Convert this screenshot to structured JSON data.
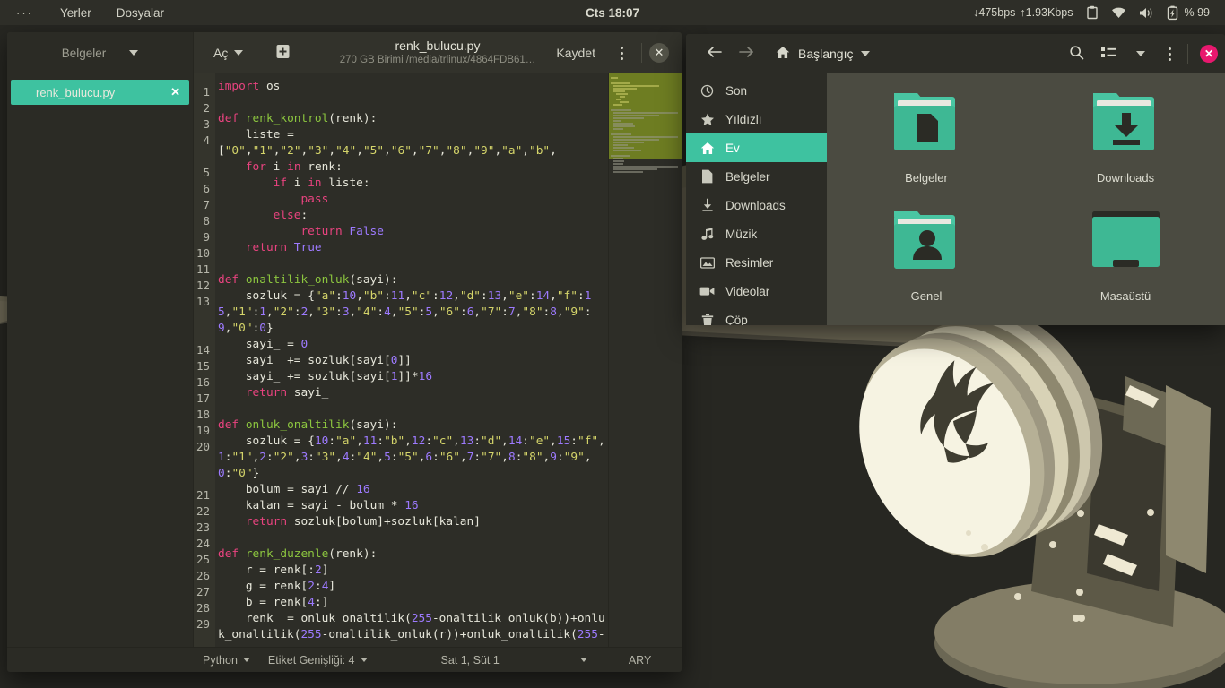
{
  "topbar": {
    "menu_dots": "···",
    "places_label": "Yerler",
    "files_label": "Dosyalar",
    "clock": "Cts 18:07",
    "network_down": "↓475bps",
    "network_up": "↑1.93Kbps",
    "battery_percent": "% 99",
    "icons": [
      "clipboard-icon",
      "wifi-icon",
      "volume-icon",
      "battery-charging-icon"
    ]
  },
  "editor": {
    "sidebar_header": "Belgeler",
    "open_label": "Aç",
    "save_label": "Kaydet",
    "title": "renk_bulucu.py",
    "subtitle": "270 GB Birimi /media/trlinux/4864FDB61…",
    "tab_label": "renk_bulucu.py",
    "tab_close": "✕",
    "window_close": "✕",
    "status": {
      "language": "Python",
      "tab_width": "Etiket Genişliği: 4",
      "cursor": "Sat 1, Süt 1",
      "mode": "ARY"
    },
    "line_numbers": [
      "1",
      "2",
      "3",
      "4",
      "5",
      "6",
      "7",
      "8",
      "9",
      "10",
      "11",
      "12",
      "13",
      "14",
      "15",
      "16",
      "17",
      "18",
      "19",
      "20",
      "21",
      "22",
      "23",
      "24",
      "25",
      "26",
      "27",
      "28",
      "29"
    ],
    "code_lines": [
      {
        "n": 1,
        "text": "import os"
      },
      {
        "n": 2,
        "text": ""
      },
      {
        "n": 3,
        "text": "def renk_kontrol(renk):"
      },
      {
        "n": 4,
        "text": "    liste = [\"0\",\"1\",\"2\",\"3\",\"4\",\"5\",\"6\",\"7\",\"8\",\"9\",\"a\",\"b\","
      },
      {
        "n": 5,
        "text": "    for i in renk:"
      },
      {
        "n": 6,
        "text": "        if i in liste:"
      },
      {
        "n": 7,
        "text": "            pass"
      },
      {
        "n": 8,
        "text": "        else:"
      },
      {
        "n": 9,
        "text": "            return False"
      },
      {
        "n": 10,
        "text": "    return True"
      },
      {
        "n": 11,
        "text": ""
      },
      {
        "n": 12,
        "text": "def onaltilik_onluk(sayi):"
      },
      {
        "n": 13,
        "text": "    sozluk = {\"a\":10,\"b\":11,\"c\":12,\"d\":13,\"e\":14,\"f\":15,\"1\":1,\"2\":2,\"3\":3,\"4\":4,\"5\":5,\"6\":6,\"7\":7,\"8\":8,\"9\":9,\"0\":0}"
      },
      {
        "n": 14,
        "text": "    sayi_ = 0"
      },
      {
        "n": 15,
        "text": "    sayi_ += sozluk[sayi[0]]"
      },
      {
        "n": 16,
        "text": "    sayi_ += sozluk[sayi[1]]*16"
      },
      {
        "n": 17,
        "text": "    return sayi_"
      },
      {
        "n": 18,
        "text": ""
      },
      {
        "n": 19,
        "text": "def onluk_onaltilik(sayi):"
      },
      {
        "n": 20,
        "text": "    sozluk = {10:\"a\",11:\"b\",12:\"c\",13:\"d\",14:\"e\",15:\"f\",1:\"1\",2:\"2\",3:\"3\",4:\"4\",5:\"5\",6:\"6\",7:\"7\",8:\"8\",9:\"9\",0:\"0\"}"
      },
      {
        "n": 21,
        "text": "    bolum = sayi // 16"
      },
      {
        "n": 22,
        "text": "    kalan = sayi - bolum * 16"
      },
      {
        "n": 23,
        "text": "    return sozluk[bolum]+sozluk[kalan]"
      },
      {
        "n": 24,
        "text": ""
      },
      {
        "n": 25,
        "text": "def renk_duzenle(renk):"
      },
      {
        "n": 26,
        "text": "    r = renk[:2]"
      },
      {
        "n": 27,
        "text": "    g = renk[2:4]"
      },
      {
        "n": 28,
        "text": "    b = renk[4:]"
      },
      {
        "n": 29,
        "text": "    renk_ = onluk_onaltilik(255-onaltilik_onluk(b))+onluk_onaltilik(255-onaltilik_onluk(r))+onluk_onaltilik(255-"
      }
    ]
  },
  "filemanager": {
    "breadcrumb": "Başlangıç",
    "back_icon": "arrow-left-icon",
    "forward_icon": "arrow-right-icon",
    "home_icon": "home-icon",
    "search_icon": "search-icon",
    "view_icon": "list-view-icon",
    "close_label": "✕",
    "sidebar": [
      {
        "label": "Son",
        "icon": "clock-icon",
        "active": false
      },
      {
        "label": "Yıldızlı",
        "icon": "star-icon",
        "active": false
      },
      {
        "label": "Ev",
        "icon": "home-icon",
        "active": true
      },
      {
        "label": "Belgeler",
        "icon": "document-icon",
        "active": false
      },
      {
        "label": "Downloads",
        "icon": "download-icon",
        "active": false
      },
      {
        "label": "Müzik",
        "icon": "music-icon",
        "active": false
      },
      {
        "label": "Resimler",
        "icon": "image-icon",
        "active": false
      },
      {
        "label": "Videolar",
        "icon": "video-icon",
        "active": false
      },
      {
        "label": "Çöp",
        "icon": "trash-icon",
        "active": false
      }
    ],
    "folders": [
      {
        "label": "Belgeler",
        "icon": "folder-documents-icon"
      },
      {
        "label": "Downloads",
        "icon": "folder-downloads-icon"
      },
      {
        "label": "Genel",
        "icon": "folder-public-icon"
      },
      {
        "label": "Masaüstü",
        "icon": "folder-desktop-icon"
      }
    ]
  },
  "colors": {
    "accent": "#3ec2a0",
    "panel": "#2e2e28",
    "window": "#2c2c26",
    "code_bg": "#2d2d27",
    "close_pink": "#e8186e",
    "minimap_view": "#6e7d22"
  },
  "wallpaper": {
    "name": "spotlight-eagle-wallpaper"
  }
}
